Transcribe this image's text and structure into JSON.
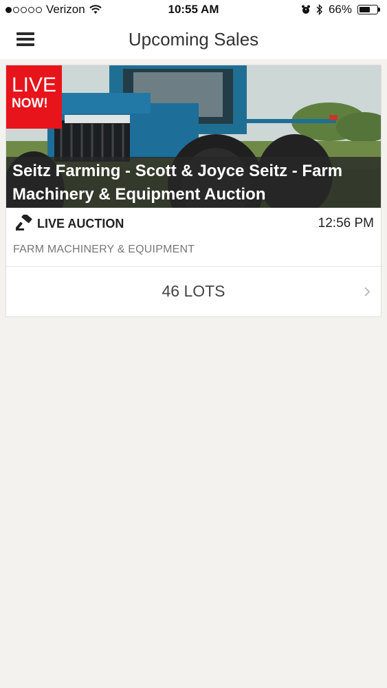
{
  "status_bar": {
    "carrier": "Verizon",
    "time": "10:55 AM",
    "battery_pct": "66%",
    "battery_level": 0.66,
    "signal_bars_filled": 1,
    "signal_bars_total": 5
  },
  "header": {
    "title": "Upcoming Sales",
    "menu_icon": "hamburger-menu-icon"
  },
  "sale": {
    "badge_line1": "LIVE",
    "badge_line2": "NOW!",
    "title": "Seitz Farming - Scott & Joyce Seitz - Farm Machinery & Equipment Auction",
    "auction_type": "LIVE AUCTION",
    "auction_icon": "gavel-icon",
    "time": "12:56 PM",
    "category": "FARM MACHINERY & EQUIPMENT",
    "lots_label": "46 LOTS",
    "badge_color": "#e8141b"
  }
}
